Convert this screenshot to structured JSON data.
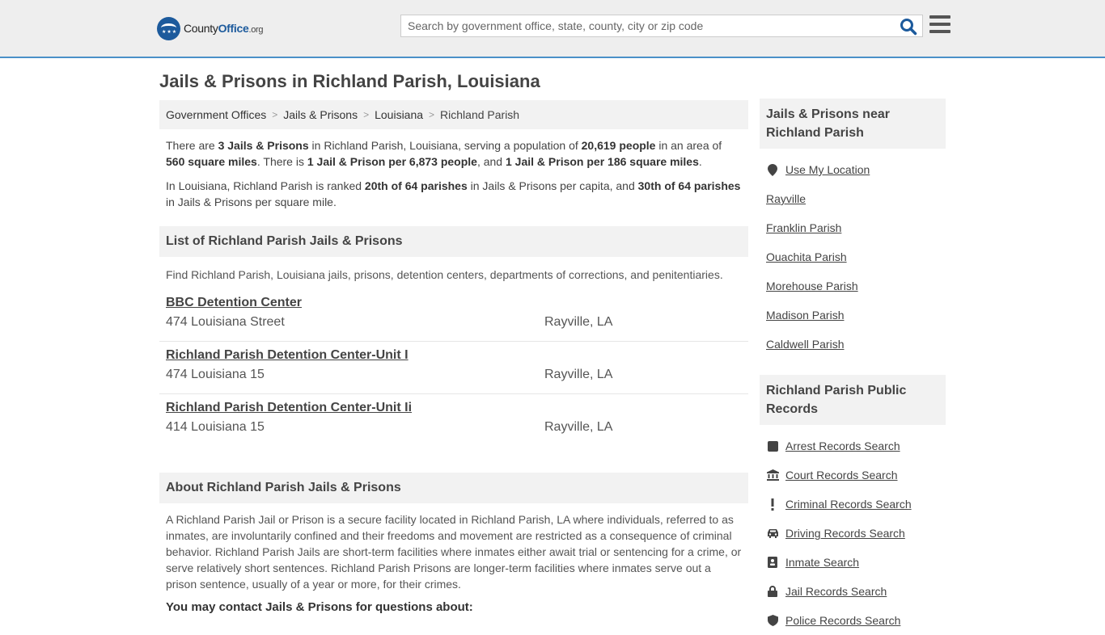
{
  "header": {
    "logo": {
      "name": "County",
      "name_bold": "Office",
      "tld": ".org"
    },
    "search_placeholder": "Search by government office, state, county, city or zip code"
  },
  "page_title": "Jails & Prisons in Richland Parish, Louisiana",
  "breadcrumb": [
    "Government Offices",
    "Jails & Prisons",
    "Louisiana",
    "Richland Parish"
  ],
  "summary": {
    "p1": {
      "t1": "There are ",
      "b1": "3 Jails & Prisons",
      "t2": " in Richland Parish, Louisiana, serving a population of ",
      "b2": "20,619 people",
      "t3": " in an area of ",
      "b3": "560 square miles",
      "t4": ". There is ",
      "b4": "1 Jail & Prison per 6,873 people",
      "t5": ", and ",
      "b5": "1 Jail & Prison per 186 square miles",
      "t6": "."
    },
    "p2": {
      "t1": "In Louisiana, Richland Parish is ranked ",
      "b1": "20th of 64 parishes",
      "t2": " in Jails & Prisons per capita, and ",
      "b2": "30th of 64 parishes",
      "t3": " in Jails & Prisons per square mile."
    }
  },
  "list_section": {
    "title": "List of Richland Parish Jails & Prisons",
    "intro": "Find Richland Parish, Louisiana jails, prisons, detention centers, departments of corrections, and penitentiaries.",
    "items": [
      {
        "name": "BBC Detention Center",
        "address": "474 Louisiana Street",
        "city": "Rayville, LA"
      },
      {
        "name": "Richland Parish Detention Center-Unit I",
        "address": "474 Louisiana 15",
        "city": "Rayville, LA"
      },
      {
        "name": "Richland Parish Detention Center-Unit Ii",
        "address": "414 Louisiana 15",
        "city": "Rayville, LA"
      }
    ]
  },
  "about": {
    "title": "About Richland Parish Jails & Prisons",
    "text": "A Richland Parish Jail or Prison is a secure facility located in Richland Parish, LA where individuals, referred to as inmates, are involuntarily confined and their freedoms and movement are restricted as a consequence of criminal behavior. Richland Parish Jails are short-term facilities where inmates either await trial or sentencing for a crime, or serve relatively short sentences. Richland Parish Prisons are longer-term facilities where inmates serve out a prison sentence, usually of a year or more, for their crimes.",
    "contact_heading": "You may contact Jails & Prisons for questions about:"
  },
  "sidebar": {
    "nearby_title": "Jails & Prisons near Richland Parish",
    "nearby": [
      {
        "label": "Use My Location",
        "icon": "location-pin-icon"
      },
      {
        "label": "Rayville"
      },
      {
        "label": "Franklin Parish"
      },
      {
        "label": "Ouachita Parish"
      },
      {
        "label": "Morehouse Parish"
      },
      {
        "label": "Madison Parish"
      },
      {
        "label": "Caldwell Parish"
      }
    ],
    "records_title": "Richland Parish Public Records",
    "records": [
      {
        "label": "Arrest Records Search",
        "icon": "square-icon"
      },
      {
        "label": "Court Records Search",
        "icon": "courthouse-icon"
      },
      {
        "label": "Criminal Records Search",
        "icon": "exclamation-icon"
      },
      {
        "label": "Driving Records Search",
        "icon": "car-icon"
      },
      {
        "label": "Inmate Search",
        "icon": "id-badge-icon"
      },
      {
        "label": "Jail Records Search",
        "icon": "lock-icon"
      },
      {
        "label": "Police Records Search",
        "icon": "shield-icon"
      }
    ]
  },
  "colors": {
    "accent": "#4a90c8",
    "brand": "#1c5a9c",
    "search_icon": "#1c5a9c"
  }
}
